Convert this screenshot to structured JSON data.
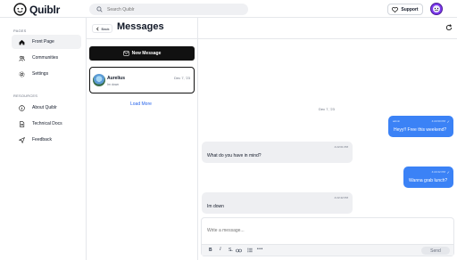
{
  "app": {
    "name": "Quiblr"
  },
  "search": {
    "placeholder": "Search Quiblr"
  },
  "header": {
    "support_label": "Support"
  },
  "sidebar": {
    "pages_title": "PAGES",
    "pages": [
      {
        "label": "Front Page",
        "icon": "home-icon",
        "active": true
      },
      {
        "label": "Communities",
        "icon": "users-icon"
      },
      {
        "label": "Settings",
        "icon": "gear-icon"
      }
    ],
    "resources_title": "RESOURCES",
    "resources": [
      {
        "label": "About Quiblr",
        "icon": "info-icon"
      },
      {
        "label": "Technical Docs",
        "icon": "document-icon"
      },
      {
        "label": "Feedback",
        "icon": "send-icon"
      }
    ]
  },
  "messages_page": {
    "back_label": "Back",
    "title": "Messages",
    "new_message_label": "New Message",
    "load_more_label": "Load More"
  },
  "conversations": [
    {
      "name": "Aurelius",
      "date": "Dec 7, '23",
      "preview": "Im down"
    }
  ],
  "chat": {
    "date_separator": "Dec 7, '23",
    "messages": [
      {
        "direction": "out",
        "sender": "admin",
        "time": "4:22:00 PM",
        "text": "Heyy!! Free this weekend?"
      },
      {
        "direction": "in",
        "time": "4:22:01 PM",
        "text": "What do you have in mind?"
      },
      {
        "direction": "out",
        "time": "4:22:22 PM",
        "text": "Wanna grab lunch?"
      },
      {
        "direction": "in",
        "time": "4:22:42 PM",
        "text": "Im down"
      }
    ]
  },
  "composer": {
    "placeholder": "Write a message...",
    "send_label": "Send"
  },
  "colors": {
    "accent": "#3b82f6",
    "primary_button": "#111111",
    "link": "#2563eb"
  }
}
